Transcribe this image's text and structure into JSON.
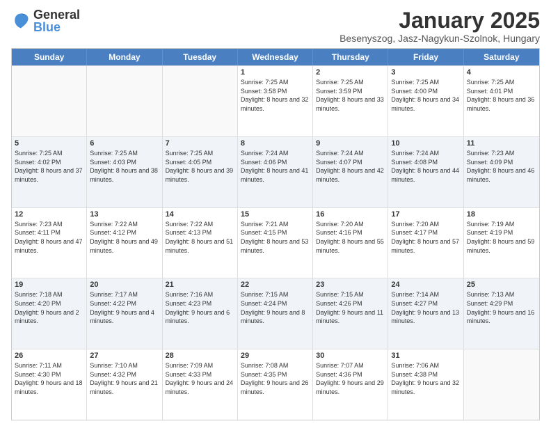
{
  "logo": {
    "general": "General",
    "blue": "Blue"
  },
  "header": {
    "month": "January 2025",
    "location": "Besenyszog, Jasz-Nagykun-Szolnok, Hungary"
  },
  "weekdays": [
    "Sunday",
    "Monday",
    "Tuesday",
    "Wednesday",
    "Thursday",
    "Friday",
    "Saturday"
  ],
  "weeks": [
    [
      {
        "day": "",
        "sunrise": "",
        "sunset": "",
        "daylight": "",
        "empty": true
      },
      {
        "day": "",
        "sunrise": "",
        "sunset": "",
        "daylight": "",
        "empty": true
      },
      {
        "day": "",
        "sunrise": "",
        "sunset": "",
        "daylight": "",
        "empty": true
      },
      {
        "day": "1",
        "sunrise": "Sunrise: 7:25 AM",
        "sunset": "Sunset: 3:58 PM",
        "daylight": "Daylight: 8 hours and 32 minutes."
      },
      {
        "day": "2",
        "sunrise": "Sunrise: 7:25 AM",
        "sunset": "Sunset: 3:59 PM",
        "daylight": "Daylight: 8 hours and 33 minutes."
      },
      {
        "day": "3",
        "sunrise": "Sunrise: 7:25 AM",
        "sunset": "Sunset: 4:00 PM",
        "daylight": "Daylight: 8 hours and 34 minutes."
      },
      {
        "day": "4",
        "sunrise": "Sunrise: 7:25 AM",
        "sunset": "Sunset: 4:01 PM",
        "daylight": "Daylight: 8 hours and 36 minutes."
      }
    ],
    [
      {
        "day": "5",
        "sunrise": "Sunrise: 7:25 AM",
        "sunset": "Sunset: 4:02 PM",
        "daylight": "Daylight: 8 hours and 37 minutes."
      },
      {
        "day": "6",
        "sunrise": "Sunrise: 7:25 AM",
        "sunset": "Sunset: 4:03 PM",
        "daylight": "Daylight: 8 hours and 38 minutes."
      },
      {
        "day": "7",
        "sunrise": "Sunrise: 7:25 AM",
        "sunset": "Sunset: 4:05 PM",
        "daylight": "Daylight: 8 hours and 39 minutes."
      },
      {
        "day": "8",
        "sunrise": "Sunrise: 7:24 AM",
        "sunset": "Sunset: 4:06 PM",
        "daylight": "Daylight: 8 hours and 41 minutes."
      },
      {
        "day": "9",
        "sunrise": "Sunrise: 7:24 AM",
        "sunset": "Sunset: 4:07 PM",
        "daylight": "Daylight: 8 hours and 42 minutes."
      },
      {
        "day": "10",
        "sunrise": "Sunrise: 7:24 AM",
        "sunset": "Sunset: 4:08 PM",
        "daylight": "Daylight: 8 hours and 44 minutes."
      },
      {
        "day": "11",
        "sunrise": "Sunrise: 7:23 AM",
        "sunset": "Sunset: 4:09 PM",
        "daylight": "Daylight: 8 hours and 46 minutes."
      }
    ],
    [
      {
        "day": "12",
        "sunrise": "Sunrise: 7:23 AM",
        "sunset": "Sunset: 4:11 PM",
        "daylight": "Daylight: 8 hours and 47 minutes."
      },
      {
        "day": "13",
        "sunrise": "Sunrise: 7:22 AM",
        "sunset": "Sunset: 4:12 PM",
        "daylight": "Daylight: 8 hours and 49 minutes."
      },
      {
        "day": "14",
        "sunrise": "Sunrise: 7:22 AM",
        "sunset": "Sunset: 4:13 PM",
        "daylight": "Daylight: 8 hours and 51 minutes."
      },
      {
        "day": "15",
        "sunrise": "Sunrise: 7:21 AM",
        "sunset": "Sunset: 4:15 PM",
        "daylight": "Daylight: 8 hours and 53 minutes."
      },
      {
        "day": "16",
        "sunrise": "Sunrise: 7:20 AM",
        "sunset": "Sunset: 4:16 PM",
        "daylight": "Daylight: 8 hours and 55 minutes."
      },
      {
        "day": "17",
        "sunrise": "Sunrise: 7:20 AM",
        "sunset": "Sunset: 4:17 PM",
        "daylight": "Daylight: 8 hours and 57 minutes."
      },
      {
        "day": "18",
        "sunrise": "Sunrise: 7:19 AM",
        "sunset": "Sunset: 4:19 PM",
        "daylight": "Daylight: 8 hours and 59 minutes."
      }
    ],
    [
      {
        "day": "19",
        "sunrise": "Sunrise: 7:18 AM",
        "sunset": "Sunset: 4:20 PM",
        "daylight": "Daylight: 9 hours and 2 minutes."
      },
      {
        "day": "20",
        "sunrise": "Sunrise: 7:17 AM",
        "sunset": "Sunset: 4:22 PM",
        "daylight": "Daylight: 9 hours and 4 minutes."
      },
      {
        "day": "21",
        "sunrise": "Sunrise: 7:16 AM",
        "sunset": "Sunset: 4:23 PM",
        "daylight": "Daylight: 9 hours and 6 minutes."
      },
      {
        "day": "22",
        "sunrise": "Sunrise: 7:15 AM",
        "sunset": "Sunset: 4:24 PM",
        "daylight": "Daylight: 9 hours and 8 minutes."
      },
      {
        "day": "23",
        "sunrise": "Sunrise: 7:15 AM",
        "sunset": "Sunset: 4:26 PM",
        "daylight": "Daylight: 9 hours and 11 minutes."
      },
      {
        "day": "24",
        "sunrise": "Sunrise: 7:14 AM",
        "sunset": "Sunset: 4:27 PM",
        "daylight": "Daylight: 9 hours and 13 minutes."
      },
      {
        "day": "25",
        "sunrise": "Sunrise: 7:13 AM",
        "sunset": "Sunset: 4:29 PM",
        "daylight": "Daylight: 9 hours and 16 minutes."
      }
    ],
    [
      {
        "day": "26",
        "sunrise": "Sunrise: 7:11 AM",
        "sunset": "Sunset: 4:30 PM",
        "daylight": "Daylight: 9 hours and 18 minutes."
      },
      {
        "day": "27",
        "sunrise": "Sunrise: 7:10 AM",
        "sunset": "Sunset: 4:32 PM",
        "daylight": "Daylight: 9 hours and 21 minutes."
      },
      {
        "day": "28",
        "sunrise": "Sunrise: 7:09 AM",
        "sunset": "Sunset: 4:33 PM",
        "daylight": "Daylight: 9 hours and 24 minutes."
      },
      {
        "day": "29",
        "sunrise": "Sunrise: 7:08 AM",
        "sunset": "Sunset: 4:35 PM",
        "daylight": "Daylight: 9 hours and 26 minutes."
      },
      {
        "day": "30",
        "sunrise": "Sunrise: 7:07 AM",
        "sunset": "Sunset: 4:36 PM",
        "daylight": "Daylight: 9 hours and 29 minutes."
      },
      {
        "day": "31",
        "sunrise": "Sunrise: 7:06 AM",
        "sunset": "Sunset: 4:38 PM",
        "daylight": "Daylight: 9 hours and 32 minutes."
      },
      {
        "day": "",
        "sunrise": "",
        "sunset": "",
        "daylight": "",
        "empty": true
      }
    ]
  ]
}
